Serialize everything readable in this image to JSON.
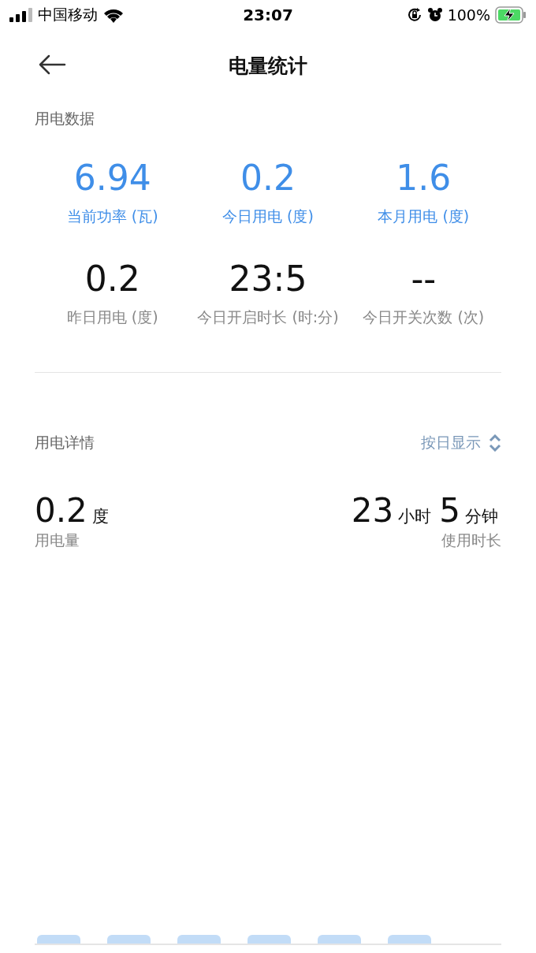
{
  "status_bar": {
    "carrier": "中国移动",
    "time": "23:07",
    "battery": "100%"
  },
  "header": {
    "title": "电量统计"
  },
  "power_data": {
    "title": "用电数据",
    "rows": [
      {
        "highlight": true,
        "stats": [
          {
            "value": "6.94",
            "label": "当前功率 (瓦)"
          },
          {
            "value": "0.2",
            "label": "今日用电 (度)"
          },
          {
            "value": "1.6",
            "label": "本月用电 (度)"
          }
        ]
      },
      {
        "highlight": false,
        "stats": [
          {
            "value": "0.2",
            "label": "昨日用电 (度)"
          },
          {
            "value": "23:5",
            "label": "今日开启时长 (时:分)"
          },
          {
            "value": "--",
            "label": "今日开关次数 (次)"
          }
        ]
      }
    ]
  },
  "details": {
    "title": "用电详情",
    "period_selector": "按日显示",
    "usage": {
      "value": "0.2",
      "unit": "度",
      "label": "用电量"
    },
    "duration": {
      "hours": "23",
      "hours_unit": "小时",
      "minutes": "5",
      "minutes_unit": "分钟",
      "label": "使用时长"
    }
  }
}
